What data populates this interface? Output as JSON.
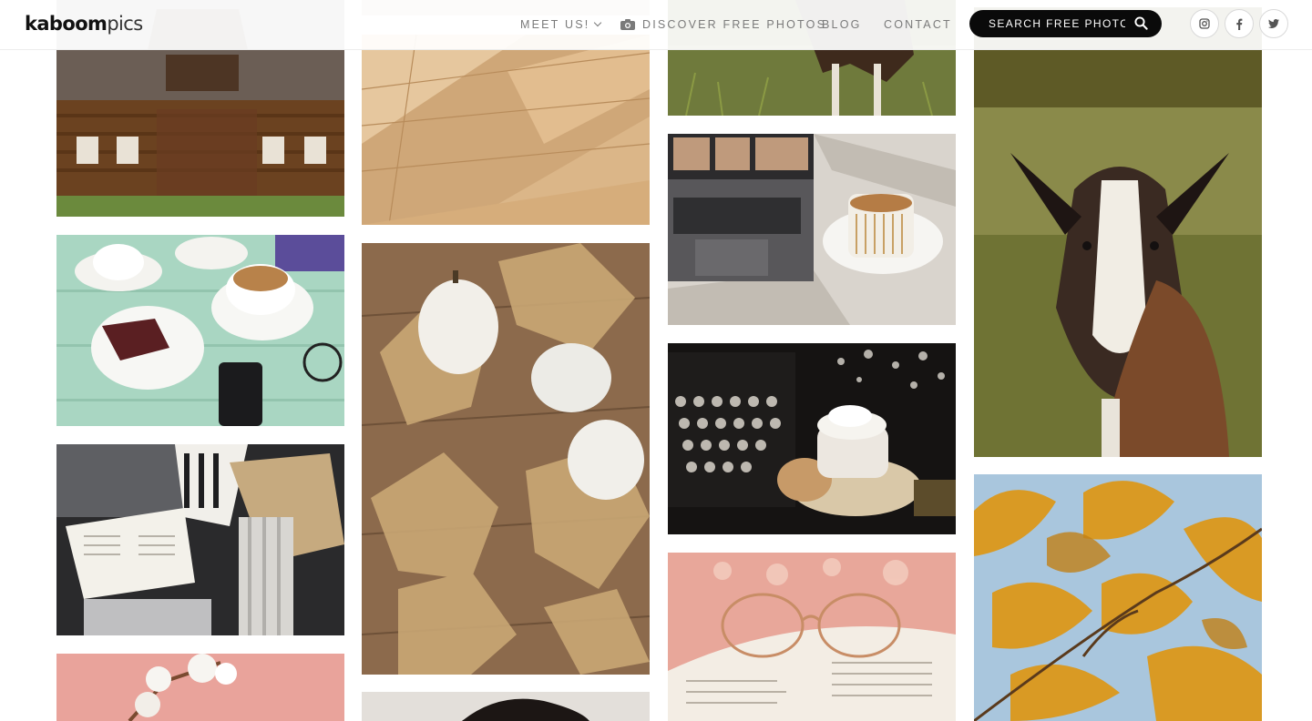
{
  "header": {
    "logo_primary": "kaboom",
    "logo_secondary": "pics",
    "nav": {
      "meet": "MEET US!",
      "discover": "DISCOVER FREE PHOTOS",
      "blog": "BLOG",
      "contact": "CONTACT"
    },
    "search": {
      "placeholder": "SEARCH FREE PHOTOS..."
    },
    "social": [
      {
        "icon": "instagram-icon"
      },
      {
        "icon": "facebook-icon"
      },
      {
        "icon": "twitter-icon"
      }
    ]
  },
  "gallery": {
    "photos": [
      {
        "subject": "wooden-house"
      },
      {
        "subject": "parquet-floor"
      },
      {
        "subject": "goat-grass"
      },
      {
        "subject": "goat-portrait"
      },
      {
        "subject": "laptop-coffee"
      },
      {
        "subject": "coffee-cake-table"
      },
      {
        "subject": "pumpkins-autumn-leaves"
      },
      {
        "subject": "typewriter-cappuccino"
      },
      {
        "subject": "reading-book-flowers"
      },
      {
        "subject": "autumn-leaves-sky"
      },
      {
        "subject": "glasses-on-book"
      },
      {
        "subject": "cotton-pink"
      },
      {
        "subject": "woman-portrait"
      }
    ]
  }
}
